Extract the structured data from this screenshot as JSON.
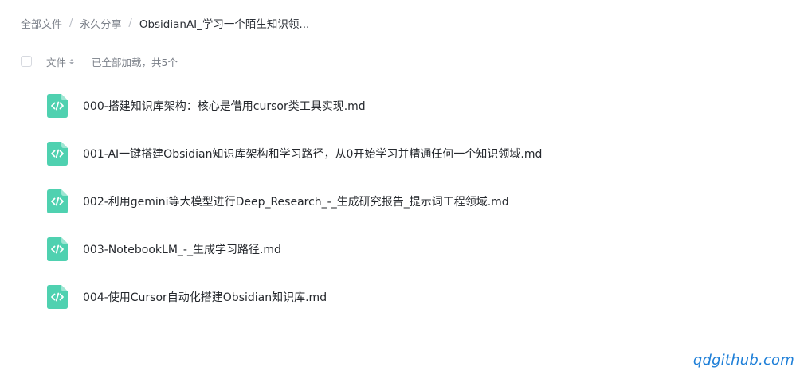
{
  "breadcrumb": {
    "root": "全部文件",
    "level1": "永久分享",
    "current": "ObsidianAI_学习一个陌生知识领...",
    "separator": "/"
  },
  "list_header": {
    "column_name": "文件",
    "status": "已全部加载，共5个"
  },
  "files": [
    {
      "name": "000-搭建知识库架构：核心是借用cursor类工具实现.md",
      "icon": "code-file-icon"
    },
    {
      "name": "001-AI一键搭建Obsidian知识库架构和学习路径，从0开始学习并精通任何一个知识领域.md",
      "icon": "code-file-icon"
    },
    {
      "name": "002-利用gemini等大模型进行Deep_Research_-_生成研究报告_提示词工程领域.md",
      "icon": "code-file-icon"
    },
    {
      "name": "003-NotebookLM_-_生成学习路径.md",
      "icon": "code-file-icon"
    },
    {
      "name": "004-使用Cursor自动化搭建Obsidian知识库.md",
      "icon": "code-file-icon"
    }
  ],
  "colors": {
    "file_icon": "#4fd1b0",
    "watermark": "#1e7fd8"
  },
  "watermark": "qdgithub.com"
}
